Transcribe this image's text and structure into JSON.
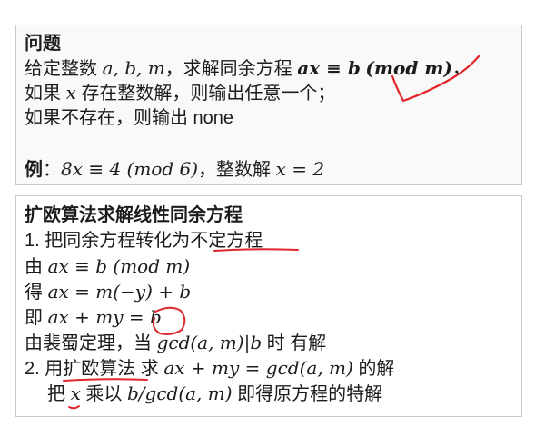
{
  "problem": {
    "title": "问题",
    "line1": {
      "text": "给定整数 ",
      "vars": "a, b, m",
      "mid": "，求解同余方程 ",
      "eq": "ax ≡ b",
      "mod": "(mod m)",
      "tail": "，"
    },
    "line2": {
      "prefix": "如果 ",
      "var": "x",
      "suffix": " 存在整数解，则输出任意一个；"
    },
    "line3": "如果不存在，则输出 none",
    "example": {
      "label": "例",
      "colon": "：",
      "eq": "8x ≡ 4 (mod 6)",
      "mid": "，整数解 ",
      "answer": "x = 2"
    }
  },
  "method": {
    "title": "扩欧算法求解线性同余方程",
    "step1": {
      "prefix": "1. 把同余方程转化为",
      "highlight": "不定方程"
    },
    "from": {
      "label": "由 ",
      "eq": "ax ≡ b (mod m)"
    },
    "get": {
      "label": "得 ",
      "eq": "ax = m(−y) + b"
    },
    "ie": {
      "label": "即 ",
      "eq": "ax + my = b"
    },
    "bezout": {
      "prefix": "由裴蜀定理，当 ",
      "cond": "gcd(a, m)|b",
      "suffix": " 时 有解"
    },
    "step2": {
      "prefix": "2. 用",
      "highlight": "扩欧算法",
      "mid": " 求 ",
      "eq": "ax + my = gcd(a, m)",
      "suffix": " 的解"
    },
    "step3": {
      "prefix": "把 ",
      "var": "x",
      "mid": " 乘以 ",
      "expr": "b/gcd(a, m)",
      "suffix": " 即得原方程的特解"
    }
  },
  "colors": {
    "annotation": "#e0262a",
    "border": "#c9c9c9",
    "text": "#1c1c1c"
  }
}
